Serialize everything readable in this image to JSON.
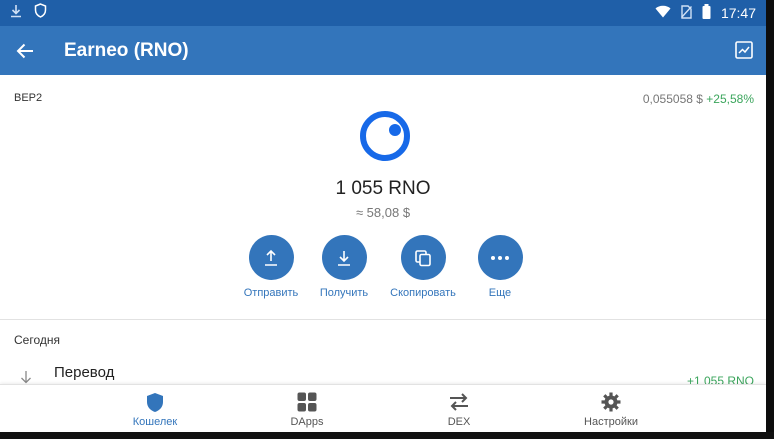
{
  "statusbar": {
    "time": "17:47"
  },
  "appbar": {
    "title": "Earneo (RNO)"
  },
  "token": {
    "network": "BEP2",
    "price": "0,055058 $",
    "change": "+25,58%",
    "balance": "1 055 RNO",
    "fiat": "≈ 58,08 $"
  },
  "actions": [
    {
      "label": "Отправить",
      "icon": "upload-icon"
    },
    {
      "label": "Получить",
      "icon": "download-icon"
    },
    {
      "label": "Скопировать",
      "icon": "copy-icon"
    },
    {
      "label": "Еще",
      "icon": "more-icon"
    }
  ],
  "history": {
    "section": "Сегодня",
    "items": [
      {
        "title": "Перевод",
        "amount": "+1 055 RNO",
        "icon": "receive-arrow-icon"
      }
    ]
  },
  "bottomnav": [
    {
      "label": "Кошелек",
      "icon": "shield-icon",
      "active": true
    },
    {
      "label": "DApps",
      "icon": "grid-icon",
      "active": false
    },
    {
      "label": "DEX",
      "icon": "swap-icon",
      "active": false
    },
    {
      "label": "Настройки",
      "icon": "gear-icon",
      "active": false
    }
  ],
  "colors": {
    "primary": "#3375bb",
    "statusbar": "#1f5fa8",
    "positive": "#3ba55c"
  }
}
